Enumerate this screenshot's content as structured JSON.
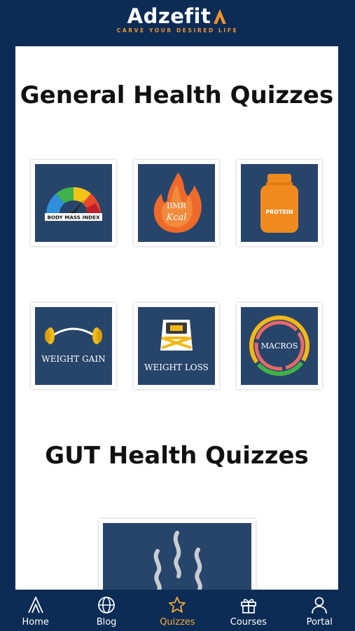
{
  "header": {
    "brand": "Adzefit",
    "tagline": "CARVE YOUR DESIRED LIFE"
  },
  "sections": [
    {
      "title": "General Health Quizzes",
      "cards": [
        {
          "name": "bmi-quiz-card",
          "image_label": "BODY MASS INDEX"
        },
        {
          "name": "bmr-quiz-card",
          "image_label": "BMR",
          "image_sublabel": "Kcal"
        },
        {
          "name": "protein-quiz-card",
          "image_label": "PROTEIN"
        },
        {
          "name": "weight-gain-quiz-card",
          "image_label": "WEIGHT GAIN"
        },
        {
          "name": "weight-loss-quiz-card",
          "image_label": "WEIGHT LOSS"
        },
        {
          "name": "macros-quiz-card",
          "image_label": "MACROS"
        }
      ]
    },
    {
      "title": "GUT Health Quizzes",
      "cards": [
        {
          "name": "gut-health-quiz-card",
          "image_label": ""
        }
      ]
    }
  ],
  "bottom_nav": {
    "items": [
      {
        "label": "Home",
        "icon": "adzefit-logo-icon",
        "active": false
      },
      {
        "label": "Blog",
        "icon": "globe-icon",
        "active": false
      },
      {
        "label": "Quizzes",
        "icon": "star-icon",
        "active": true
      },
      {
        "label": "Courses",
        "icon": "gift-icon",
        "active": false
      },
      {
        "label": "Portal",
        "icon": "user-icon",
        "active": false
      }
    ]
  },
  "colors": {
    "navy": "#0d2c55",
    "card_bg": "#27456b",
    "accent": "#f0932b",
    "active_nav": "#f0a93c"
  }
}
